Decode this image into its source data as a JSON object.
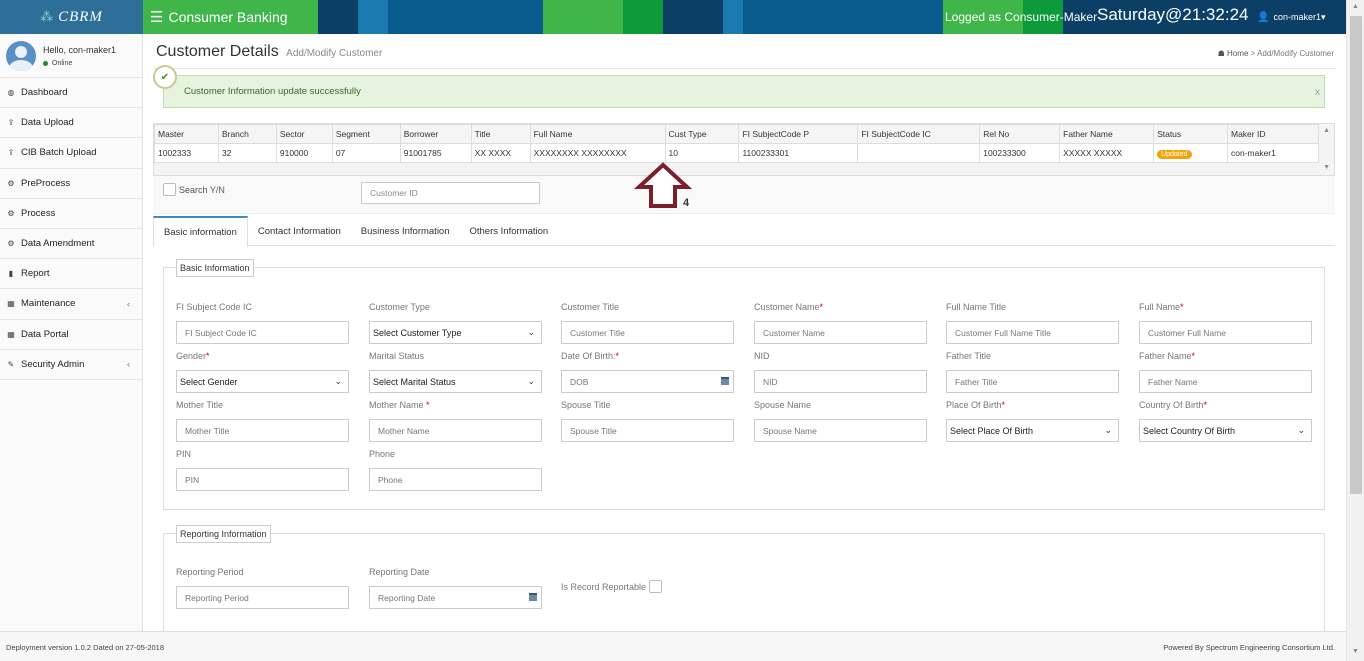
{
  "brand": {
    "name": "CBRM",
    "icon": "cbrm-logo-icon"
  },
  "header": {
    "app_title": "Consumer Banking",
    "logged_as": "Logged as Consumer-Maker",
    "clock": "Saturday@21:32:24",
    "user": "con-maker1",
    "user_caret": "▾",
    "colors": {
      "bar_base": "#0a5c8e",
      "green": "#3fb54a",
      "deep_green": "#0c9a3a",
      "navy": "#0b3f66"
    }
  },
  "sidebar": {
    "greeting": "Hello, con-maker1",
    "status": "Online",
    "items": [
      {
        "label": "Dashboard",
        "icon": "dashboard-icon",
        "glyph": "◍"
      },
      {
        "label": "Data Upload",
        "icon": "upload-icon",
        "glyph": "⇪"
      },
      {
        "label": "CIB Batch Upload",
        "icon": "upload-icon",
        "glyph": "⇪"
      },
      {
        "label": "PreProcess",
        "icon": "cogs-icon",
        "glyph": "⚙"
      },
      {
        "label": "Process",
        "icon": "cog-icon",
        "glyph": "⚙"
      },
      {
        "label": "Data Amendment",
        "icon": "cog-icon",
        "glyph": "⚙"
      },
      {
        "label": "Report",
        "icon": "bar-chart-icon",
        "glyph": "▮"
      },
      {
        "label": "Maintenance",
        "icon": "table-icon",
        "glyph": "▦",
        "chevron": "‹"
      },
      {
        "label": "Data Portal",
        "icon": "table-icon",
        "glyph": "▦"
      },
      {
        "label": "Security Admin",
        "icon": "wrench-icon",
        "glyph": "✎",
        "chevron": "‹"
      }
    ]
  },
  "page": {
    "title": "Customer Details",
    "subtitle": "Add/Modify Customer",
    "breadcrumb": {
      "home": "Home",
      "sep": ">",
      "current": "Add/Modify Customer"
    }
  },
  "alert": {
    "message": "Customer Information update successfully",
    "close": "x",
    "check": "✔"
  },
  "grid": {
    "columns": [
      "Master",
      "Branch",
      "Sector",
      "Segment",
      "Borrower",
      "Title",
      "Full Name",
      "Cust Type",
      "FI SubjectCode P",
      "FI SubjectCode IC",
      "Rel No",
      "Father Name",
      "Status",
      "Maker ID"
    ],
    "row": [
      "1002333",
      "32",
      "910000",
      "07",
      "91001785",
      "XX XXXX",
      "XXXXXXXX XXXXXXXX",
      "10",
      "1100233301",
      "",
      "100233300",
      "XXXXX XXXXX",
      "Updated",
      "con-maker1"
    ]
  },
  "search": {
    "label": "Search Y/N",
    "placeholder": "Customer ID"
  },
  "annotation": {
    "step": "4"
  },
  "tabs": [
    "Basic information",
    "Contact Information",
    "Business Information",
    "Others Information"
  ],
  "basic": {
    "legend": "Basic Information",
    "fields": [
      {
        "label": "FI Subject Code IC",
        "value": "FI Subject Code IC",
        "type": "text"
      },
      {
        "label": "Customer Type",
        "value": "Select Customer Type",
        "type": "select"
      },
      {
        "label": "Customer Title",
        "value": "Customer Title",
        "type": "text"
      },
      {
        "label": "Customer Name",
        "value": "Customer Name",
        "type": "text",
        "required": "*"
      },
      {
        "label": "Full Name Title",
        "value": "Customer Full Name Title",
        "type": "text"
      },
      {
        "label": "Full Name",
        "value": "Customer Full Name",
        "type": "text",
        "required": "*"
      },
      {
        "label": "Gender",
        "value": "Select Gender",
        "type": "select",
        "required": "*"
      },
      {
        "label": "Marital Status",
        "value": "Select Marital Status",
        "type": "select"
      },
      {
        "label": "Date Of Birth:",
        "value": "DOB",
        "type": "date",
        "required": "*"
      },
      {
        "label": "NID",
        "value": "NID",
        "type": "text"
      },
      {
        "label": "Father Title",
        "value": "Father Title",
        "type": "text"
      },
      {
        "label": "Father Name",
        "value": "Father Name",
        "type": "text",
        "required": "*"
      },
      {
        "label": "Mother Title",
        "value": "Mother Title",
        "type": "text"
      },
      {
        "label": "Mother Name ",
        "value": "Mother Name",
        "type": "text",
        "required": "*"
      },
      {
        "label": "Spouse Title",
        "value": "Spouse Title",
        "type": "text"
      },
      {
        "label": "Spouse Name",
        "value": "Spouse Name",
        "type": "text"
      },
      {
        "label": "Place Of Birth",
        "value": "Select Place Of Birth",
        "type": "select",
        "required": "*"
      },
      {
        "label": "Country Of Birth",
        "value": "Select Country Of Birth",
        "type": "select",
        "required": "*"
      },
      {
        "label": "PIN",
        "value": "PIN",
        "type": "text"
      },
      {
        "label": "Phone",
        "value": "Phone",
        "type": "text"
      }
    ]
  },
  "reporting": {
    "legend": "Reporting Information",
    "fields": [
      {
        "label": "Reporting Period",
        "value": "Reporting Period",
        "type": "text"
      },
      {
        "label": "Reporting Date",
        "value": "Reporting Date",
        "type": "date"
      }
    ],
    "reportable_label": "Is Record Reportable"
  },
  "footer": {
    "left": "Deployment version 1.0.2 Dated on 27-05-2018",
    "right": "Powered By Spectrum Engineering Consortium Ltd."
  }
}
